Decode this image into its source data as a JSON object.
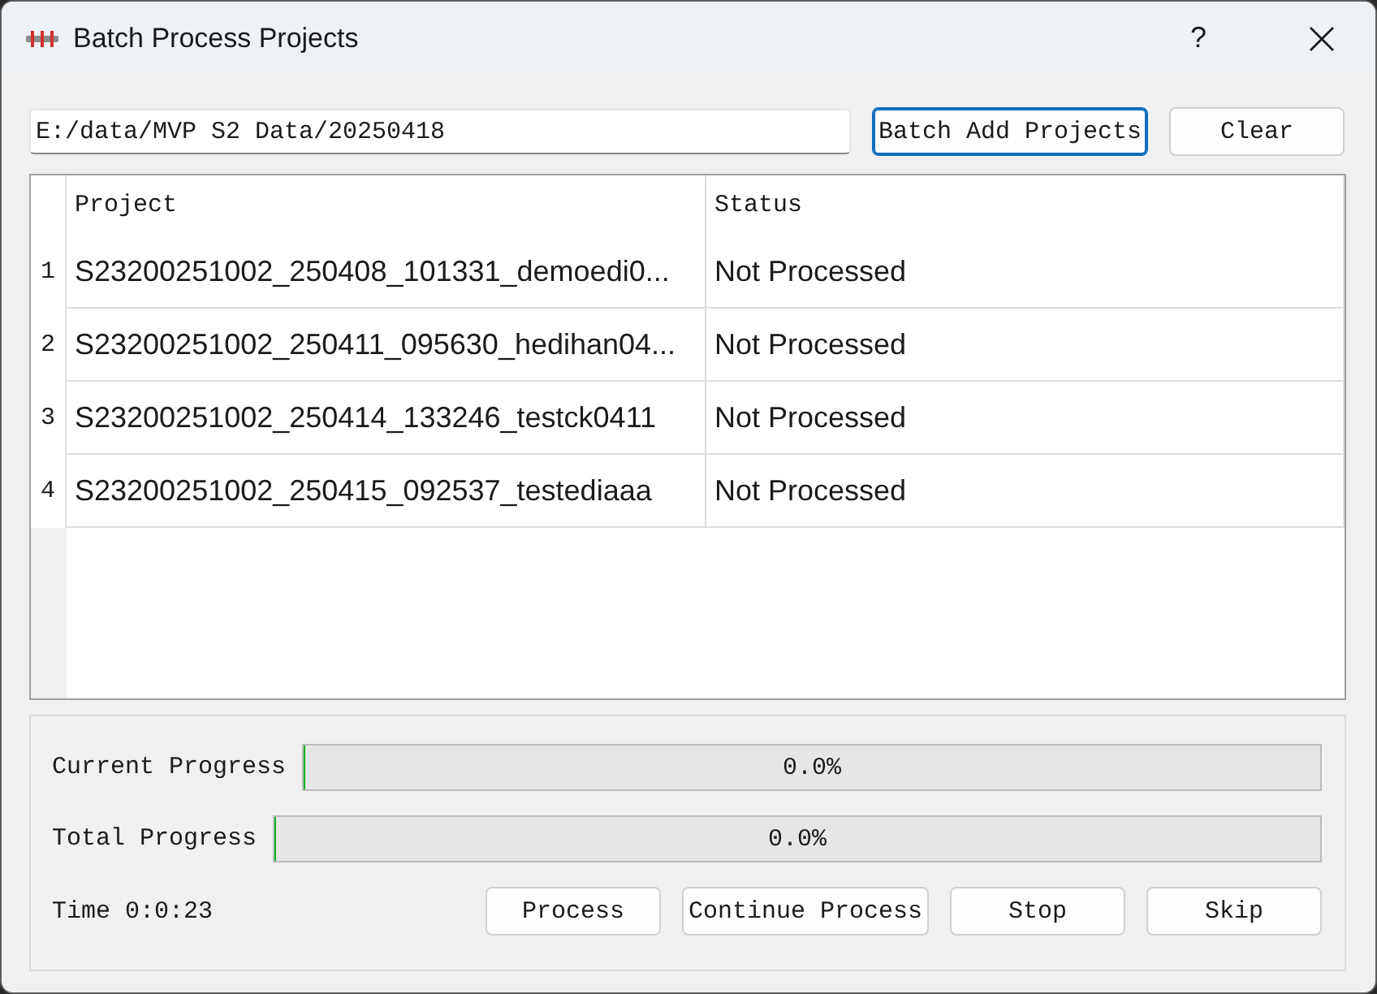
{
  "window": {
    "title": "Batch Process Projects",
    "help": "?"
  },
  "path_field": {
    "value": "E:/data/MVP S2 Data/20250418"
  },
  "top_buttons": [
    {
      "label": "Batch Add Projects",
      "focused": true
    },
    {
      "label": "Clear",
      "focused": false
    }
  ],
  "table": {
    "columns": [
      "Project",
      "Status"
    ],
    "rows": [
      {
        "number": "1",
        "project": "S23200251002_250408_101331_demoedi0...",
        "status": "Not Processed"
      },
      {
        "number": "2",
        "project": "S23200251002_250411_095630_hedihan04...",
        "status": "Not Processed"
      },
      {
        "number": "3",
        "project": "S23200251002_250414_133246_testck0411",
        "status": "Not Processed"
      },
      {
        "number": "4",
        "project": "S23200251002_250415_092537_testediaaa",
        "status": "Not Processed"
      }
    ]
  },
  "progress": [
    {
      "label": "Current Progress",
      "level": 0,
      "reading": "0.0%"
    },
    {
      "label": "Total Progress",
      "level": 0,
      "reading": "0.0%"
    }
  ],
  "time": "Time 0:0:23",
  "buttons": [
    "Process",
    "Continue Process",
    "Stop",
    "Skip"
  ]
}
